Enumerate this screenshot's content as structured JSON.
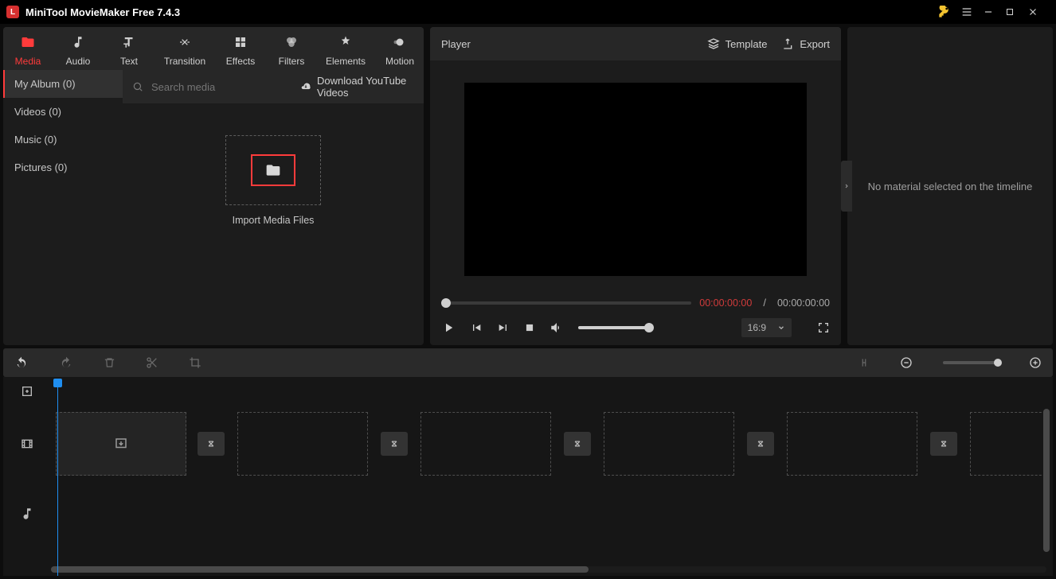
{
  "app": {
    "title": "MiniTool MovieMaker Free 7.4.3"
  },
  "toolTabs": [
    {
      "label": "Media"
    },
    {
      "label": "Audio"
    },
    {
      "label": "Text"
    },
    {
      "label": "Transition"
    },
    {
      "label": "Effects"
    },
    {
      "label": "Filters"
    },
    {
      "label": "Elements"
    },
    {
      "label": "Motion"
    }
  ],
  "mediaCats": [
    {
      "label": "My Album (0)"
    },
    {
      "label": "Videos (0)"
    },
    {
      "label": "Music (0)"
    },
    {
      "label": "Pictures (0)"
    }
  ],
  "search": {
    "placeholder": "Search media"
  },
  "youtube": {
    "label": "Download YouTube Videos"
  },
  "import": {
    "label": "Import Media Files"
  },
  "player": {
    "title": "Player",
    "templateLabel": "Template",
    "exportLabel": "Export",
    "currentTime": "00:00:00:00",
    "totalTime": "00:00:00:00",
    "ratio": "16:9"
  },
  "rightPanel": {
    "empty": "No material selected on the timeline"
  }
}
